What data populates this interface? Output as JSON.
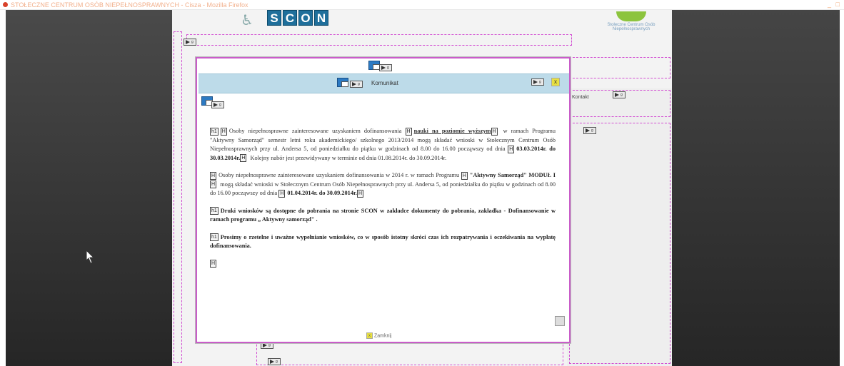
{
  "window": {
    "title": "STOŁECZNE CENTRUM OSÓB NIEPEŁNOSPRAWNYCH - Cisza - Mozilla Firefox",
    "controls": "_ □"
  },
  "page": {
    "logo_letters": [
      "S",
      "C",
      "O",
      "N"
    ],
    "org_logo_text": "Stołeczne Centrum Osób Niepełnosprawnych",
    "kontakt": "Kontakt",
    "placeholder_label": "g"
  },
  "modal": {
    "title": "Komunikat",
    "close_label": "x",
    "footer_label": "Zamknij",
    "tag_h": "H",
    "tag_h1": "h1",
    "p1_a": "Osoby niepełnosprawne zainteresowane uzyskaniem dofinansowania ",
    "p1_link": "nauki na poziomie wyższym",
    "p1_b": " w ramach Programu \"Aktywny Samorząd\" semestr letni roku akademickiego/ szkolnego 2013/2014 mogą składać wnioski w Stołecznym Centrum Osób Niepełnosprawnych przy ul. Andersa 5, od poniedziałku do piątku w godzinach od 8.00 do 16.00 począwszy od dnia ",
    "p1_dates": "03.03.2014r. do 30.03.2014r.",
    "p1_c": " Kolejny nabór jest przewidywany w terminie od dnia 01.08.2014r. do 30.09.2014r.",
    "p2_a": "Osoby niepełnosprawne zainteresowane uzyskaniem dofinansowania w 2014 r. w ramach Programu ",
    "p2_prog": "\"Aktywny Samorząd\" MODUŁ I",
    "p2_b": " mogą składać wnioski w Stołecznym Centrum Osób Niepełnosprawnych przy ul. Andersa 5, od poniedziałku do piątku w godzinach od 8.00 do 16.00 począwszy od dnia ",
    "p2_dates": "01.04.2014r. do 30.09.2014r.",
    "p3": "Druki wniosków są dostępne do pobrania na stronie SCON w zakładce dokumenty do pobrania, zakładka - Dofinansowanie w ramach programu „ Aktywny samorząd\" .",
    "p4": "Prosimy o rzetelne i uważne wypełnianie wniosków, co w sposób istotny skróci czas ich rozpatrywania i oczekiwania na wypłatę dofinansowania."
  }
}
